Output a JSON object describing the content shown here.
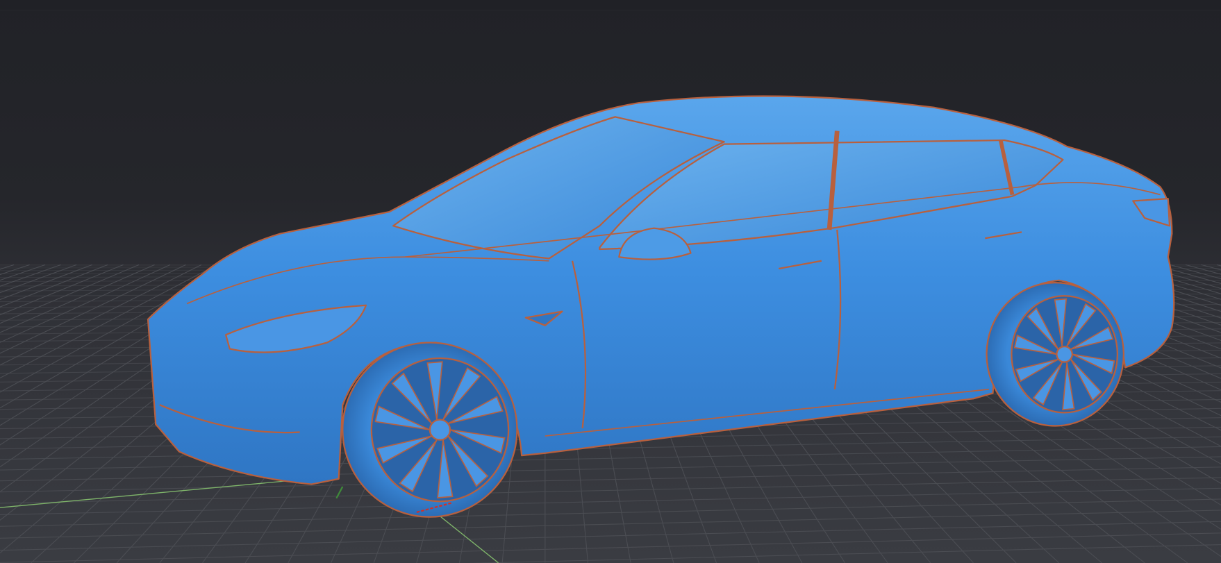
{
  "viewport": {
    "background": "#25262b",
    "grid_color": "#4a4c52",
    "axis_green": "#7fb56a",
    "axis_red": "#d0302a",
    "mesh_color": "#3d8ee0",
    "mesh_highlight": "#6fb4ee",
    "edge_color": "#b8603e"
  }
}
